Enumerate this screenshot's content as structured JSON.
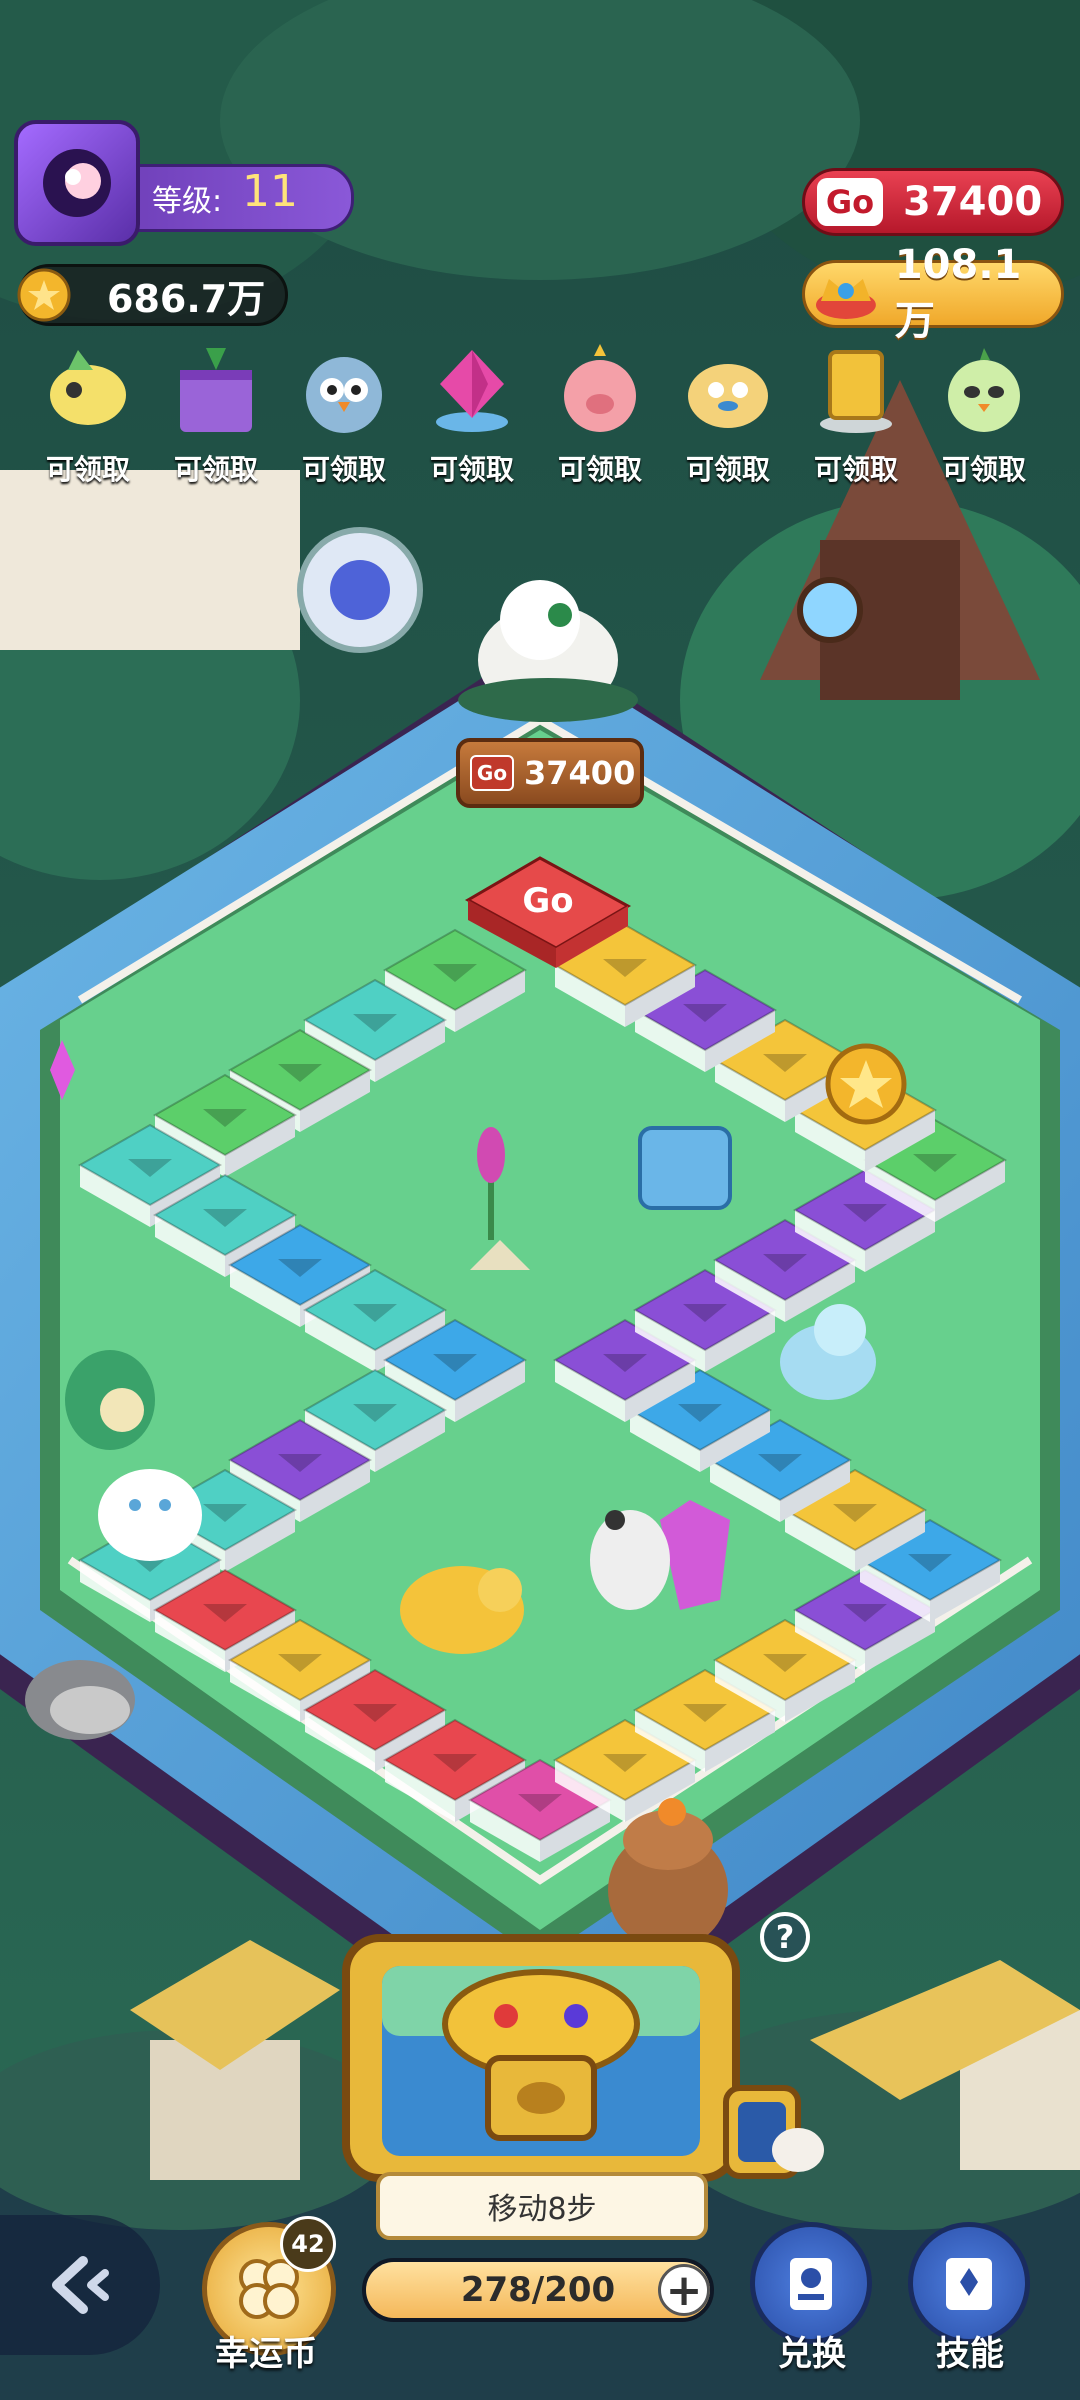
{
  "header": {
    "level_label": "等级:",
    "level_value": "11",
    "coin_balance": "686.7万",
    "go_balance": "37400",
    "gem_balance": "108.1万",
    "go_badge": "Go"
  },
  "rewards": [
    {
      "icon": "fish-pet-icon",
      "label": "可领取"
    },
    {
      "icon": "spellbook-icon",
      "label": "可领取"
    },
    {
      "icon": "owl-pet-icon",
      "label": "可领取"
    },
    {
      "icon": "pink-gem-icon",
      "label": "可领取"
    },
    {
      "icon": "pig-pet-icon",
      "label": "可领取"
    },
    {
      "icon": "pufferfish-pet-icon",
      "label": "可领取"
    },
    {
      "icon": "gold-card-icon",
      "label": "可领取"
    },
    {
      "icon": "chick-pet-icon",
      "label": "可领取"
    }
  ],
  "board": {
    "start_tile_label": "Go",
    "sign_badge": "Go",
    "sign_value": "37400"
  },
  "bottom": {
    "move_label": "移动8步",
    "lucky_coin_label": "幸运币",
    "lucky_coin_count": "42",
    "energy_text": "278/200",
    "energy_fraction": 1.0,
    "exchange_label": "兑换",
    "skill_label": "技能",
    "help_glyph": "?",
    "plus_glyph": "+"
  },
  "colors": {
    "grass": "#5fc98a",
    "water": "#5aa6d8",
    "tile_red": "#e8474f",
    "tile_green": "#5ccf6a",
    "tile_teal": "#4fd0c4",
    "tile_blue": "#3da8e8",
    "tile_purple": "#8a4fd6",
    "tile_yellow": "#f4c53a",
    "tile_pink": "#e04fa8"
  }
}
